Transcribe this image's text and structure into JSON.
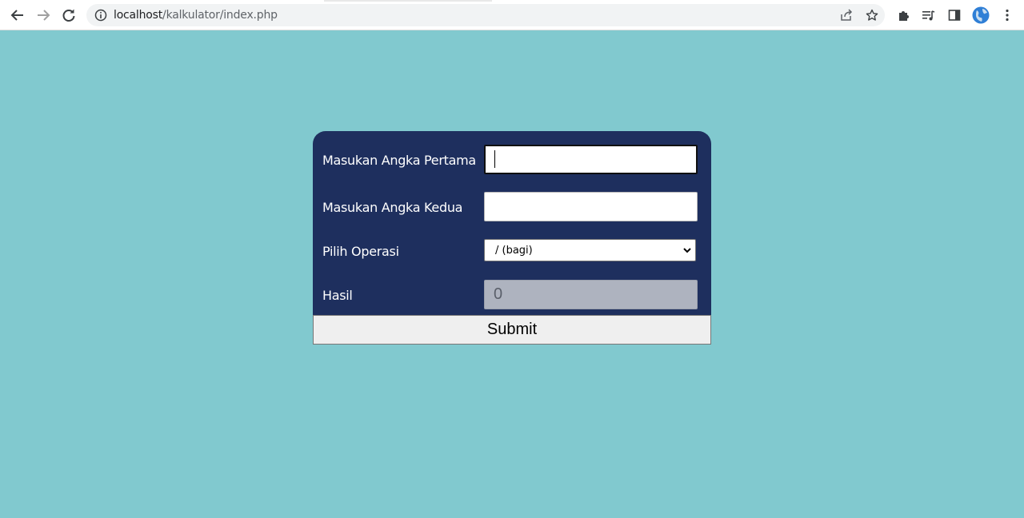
{
  "browser": {
    "url_host": "localhost",
    "url_path": "/kalkulator/index.php"
  },
  "form": {
    "first_number_label": "Masukan Angka Pertama",
    "first_number_value": "",
    "second_number_label": "Masukan Angka Kedua",
    "second_number_value": "",
    "operation_label": "Pilih Operasi",
    "operation_selected": "/ (bagi)",
    "result_label": "Hasil",
    "result_value": "0",
    "submit_label": "Submit"
  },
  "colors": {
    "page_background": "#81c9cf",
    "card_background": "#1e2f5e",
    "result_field_background": "#aeb3bf"
  }
}
